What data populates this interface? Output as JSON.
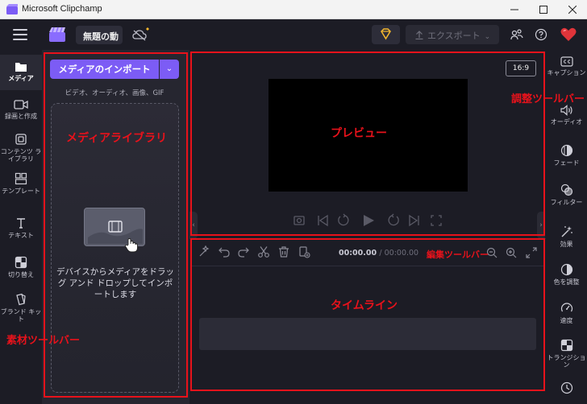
{
  "window": {
    "title": "Microsoft Clipchamp",
    "controls": [
      "minimize",
      "maximize",
      "close"
    ]
  },
  "topbar": {
    "project_name": "無題の動",
    "export_label": "エクスポート",
    "icons": [
      "menu-icon",
      "clapperboard-icon",
      "cloud-off-icon",
      "diamond-icon",
      "people-icon",
      "help-icon",
      "heart-icon"
    ]
  },
  "left_nav": {
    "items": [
      {
        "label": "メディア",
        "icon": "folder-icon",
        "active": true
      },
      {
        "label": "録画と作成",
        "icon": "video-camera-icon"
      },
      {
        "label": "コンテンツ ライブラリ",
        "icon": "content-library-icon"
      },
      {
        "label": "テンプレート",
        "icon": "templates-icon"
      },
      {
        "label": "テキスト",
        "icon": "text-icon"
      },
      {
        "label": "切り替え",
        "icon": "transition-icon"
      },
      {
        "label": "ブランド キット",
        "icon": "brand-kit-icon"
      }
    ]
  },
  "media_panel": {
    "import_label": "メディアのインポート",
    "formats": "ビデオ、オーディオ、画像、GIF",
    "drop_text": "デバイスからメディアをドラッグ アンド ドロップしてインポートします"
  },
  "preview": {
    "aspect_ratio": "16:9"
  },
  "timeline": {
    "current_time": "00:00.00",
    "total_time": "/ 00:00.00"
  },
  "right_nav": {
    "items": [
      {
        "label": "キャプション",
        "icon": "captions-icon"
      },
      {
        "label": "オーディオ",
        "icon": "audio-icon"
      },
      {
        "label": "フェード",
        "icon": "fade-icon"
      },
      {
        "label": "フィルター",
        "icon": "filter-icon"
      },
      {
        "label": "効果",
        "icon": "effects-icon"
      },
      {
        "label": "色を調整",
        "icon": "color-adjust-icon"
      },
      {
        "label": "速度",
        "icon": "speed-icon"
      },
      {
        "label": "トランジション",
        "icon": "transition-icon"
      }
    ]
  },
  "annotations": {
    "media_library": "メディアライブラリ",
    "preview": "プレビュー",
    "adjust_toolbar": "調整ツールバー",
    "edit_toolbar": "編集ツールバー",
    "timeline": "タイムライン",
    "material_toolbar": "素材ツールバー",
    "color": "#e8121b"
  }
}
